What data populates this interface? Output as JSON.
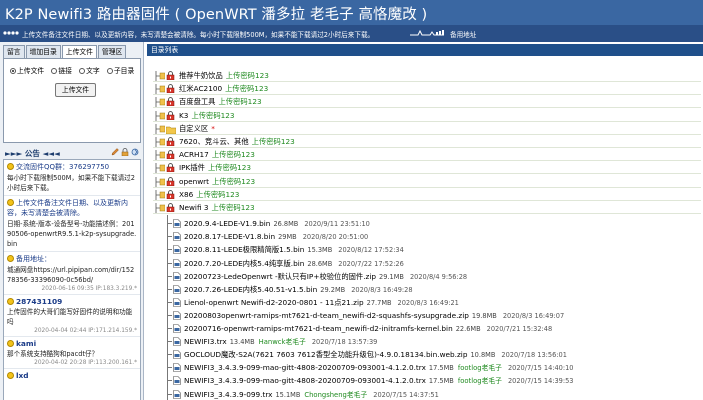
{
  "window": {
    "title": "K2P Newifi3 路由器固件 ( OpenWRT 潘多拉 老毛子 高恪魔改 )"
  },
  "marquee": {
    "text": "上传文件备注文件日期、以及更新内容，未写清楚会被清除。每小时下载限制500M，如果不能下载请过2小时后来下载。",
    "label": "备用地址"
  },
  "sidebar": {
    "tabs": [
      "留言",
      "增加目录",
      "上传文件",
      "管理区"
    ],
    "active_tab": 2,
    "upload_options": [
      {
        "label": "上传文件",
        "checked": true
      },
      {
        "label": "链接",
        "checked": false
      },
      {
        "label": "文字",
        "checked": false
      },
      {
        "label": "子目录",
        "checked": false
      }
    ],
    "upload_button": "上传文件",
    "board_title": "►►► 公告 ◄◄◄",
    "messages": [
      {
        "name": "交流固件QQ群：376297750",
        "bold": false,
        "body": "每小时下载限制500M，如果不能下载请过2小时后来下载。",
        "meta": ""
      },
      {
        "name": "上传文件备注文件日期、以及更新内容，未写清楚会被清除。",
        "bold": false,
        "body": "日期-系统-版本-设备型号-功能描述例：20190506-openwrtR9.5.1-k2p-sysupgrade.bin",
        "meta": ""
      },
      {
        "name": "备用地址：",
        "bold": false,
        "body": "城通网盘https://url.pipipan.com/dir/15278356-33396090-0c56bd/",
        "meta": "2020-06-16 09:35 IP:183.3.219.*"
      },
      {
        "name": "287431109",
        "bold": true,
        "body": "上传固件的大哥们能写好固件的说明和功能吗",
        "meta": "2020-04-04 02:44 IP:171.214.159.*"
      },
      {
        "name": "kami",
        "bold": true,
        "body": "那个系统支持酷狗和pacdt仔？",
        "meta": "2020-04-02 20:28 IP:113.200.161.*"
      },
      {
        "name": "lxd",
        "bold": true,
        "body": "",
        "meta": ""
      }
    ]
  },
  "main": {
    "header": "目录列表",
    "folders": [
      {
        "name": "推荐牛奶饮品",
        "pw": "上传密码123",
        "kind": "lock"
      },
      {
        "name": "红米AC2100",
        "pw": "上传密码123",
        "kind": "lock"
      },
      {
        "name": "百度盘工具",
        "pw": "上传密码123",
        "kind": "lock"
      },
      {
        "name": "K3",
        "pw": "上传密码123",
        "kind": "lock"
      },
      {
        "name": "自定义区",
        "pw": "*",
        "kind": "folder"
      },
      {
        "name": "7620、竞斗云、其他",
        "pw": "上传密码123",
        "kind": "lock"
      },
      {
        "name": "ACRH17",
        "pw": "上传密码123",
        "kind": "lock"
      },
      {
        "name": "IPK插件",
        "pw": "上传密码123",
        "kind": "lock"
      },
      {
        "name": "openwrt",
        "pw": "上传密码123",
        "kind": "lock"
      },
      {
        "name": "X86",
        "pw": "上传密码123",
        "kind": "lock"
      },
      {
        "name": "Newifi 3",
        "pw": "上传密码123",
        "kind": "lock"
      }
    ],
    "files": [
      {
        "name": "2020.9.4-LEDE-V1.9.bin",
        "size": "26.8MB",
        "owner": "",
        "date": "2020/9/11 23:51:10"
      },
      {
        "name": "2020.8.17-LEDE-V1.8.bin",
        "size": "29MB",
        "owner": "",
        "date": "2020/8/20 20:51:00"
      },
      {
        "name": "2020.8.11-LEDE极限精简版1.5.bin",
        "size": "15.3MB",
        "owner": "",
        "date": "2020/8/12 17:52:34"
      },
      {
        "name": "2020.7.20-LEDE内核5.4纯享版.bin",
        "size": "28.6MB",
        "owner": "",
        "date": "2020/7/22 17:52:26"
      },
      {
        "name": "20200723-LedeOpenwrt -默认只有IP+校验位的固件.zip",
        "size": "29.1MB",
        "owner": "",
        "date": "2020/8/4 9:56:28"
      },
      {
        "name": "2020.7.26-LEDE内核5.40.51-v1.5.bin",
        "size": "29.2MB",
        "owner": "",
        "date": "2020/8/3 16:49:28"
      },
      {
        "name": "Lienol-openwrt Newifi-d2-2020-0801 - 11点21.zip",
        "size": "27.7MB",
        "owner": "",
        "date": "2020/8/3 16:49:21"
      },
      {
        "name": "20200803openwrt-ramips-mt7621-d-team_newifi-d2-squashfs-sysupgrade.zip",
        "size": "19.8MB",
        "owner": "",
        "date": "2020/8/3 16:49:07"
      },
      {
        "name": "20200716-openwrt-ramips-mt7621-d-team_newifi-d2-initramfs-kernel.bin",
        "size": "22.6MB",
        "owner": "",
        "date": "2020/7/21 15:32:48"
      },
      {
        "name": "NEWIFI3.trx",
        "size": "13.4MB",
        "owner": "Hanwck老毛子",
        "date": "2020/7/18 13:57:39"
      },
      {
        "name": "GOCLOUD魔改-S2A(7621 7603 7612香型全功能升级包)-4.9.0.18134.bin.web.zip",
        "size": "10.8MB",
        "owner": "",
        "date": "2020/7/18 13:56:01"
      },
      {
        "name": "NEWIFI3_3.4.3.9-099-mao-gitt-4808-20200709-093001-4.1.2.0.trx",
        "size": "17.5MB",
        "owner": "footlog老毛子",
        "date": "2020/7/15 14:40:10"
      },
      {
        "name": "NEWIFI3_3.4.3.9-099-mao-gitt-4808-20200709-093001-4.1.2.0.trx",
        "size": "17.5MB",
        "owner": "footlog老毛子",
        "date": "2020/7/15 14:39:53"
      },
      {
        "name": "NEWIFI3_3.4.3.9-099.trx",
        "size": "15.1MB",
        "owner": "Chongsheng老毛子",
        "date": "2020/7/15 14:37:51"
      },
      {
        "name": "GOCLOUD魔改-S2A(7621 7603 7612香型全功能升级包)-4.9.0.18134.bin.web.zip",
        "size": "",
        "owner": "",
        "date": ""
      }
    ]
  }
}
